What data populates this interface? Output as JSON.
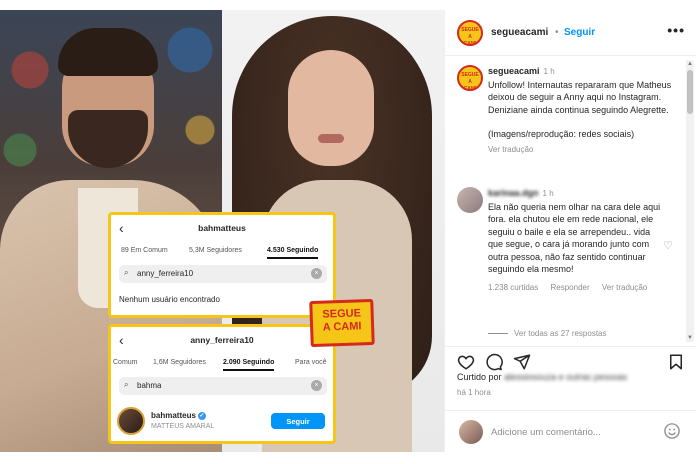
{
  "post": {
    "username": "segueacami",
    "follow_label": "Seguir",
    "dot": "•",
    "more": "•••",
    "logo_text": "SEGUE A CAMI"
  },
  "caption": {
    "username": "segueacami",
    "time": "1 h",
    "text": "Unfollow! Internautas repararam que Matheus deixou de seguir a Anny aqui no Instagram. Deniziane ainda continua seguindo Alegrette.",
    "credit": "(Imagens/reprodução: redes sociais)",
    "translate": "Ver tradução"
  },
  "comment": {
    "username": "karinaa.dgn",
    "time": "1 h",
    "text": "Ela não queria nem olhar na cara dele aqui fora. ela chutou ele em rede nacional, ele seguiu o baile e ela se arrependeu.. vida que segue, o cara já morando junto com outra pessoa, não faz sentido continuar seguindo ela mesmo!",
    "likes": "1.238 curtidas",
    "reply": "Responder",
    "translate": "Ver tradução",
    "replies": "Ver todas as 27 respostas"
  },
  "engagement": {
    "liked_prefix": "Curtido por",
    "liked_by": "alessiosouza e outras pessoas",
    "time": "há 1 hora"
  },
  "add_comment": {
    "placeholder": "Adicione um comentário..."
  },
  "photo": {
    "card1": {
      "title": "bahmatteus",
      "tabs": [
        "89 Em Comum",
        "5,3M Seguidores",
        "4.530 Seguindo"
      ],
      "search_value": "anny_ferreira10",
      "no_result": "Nenhum usuário encontrado"
    },
    "card2": {
      "title": "anny_ferreira10",
      "tabs": [
        "Comum",
        "1,6M Seguidores",
        "2.090 Seguindo",
        "Para você"
      ],
      "search_value": "bahma",
      "user_name": "bahmatteus",
      "user_full": "MATTEUS AMARAL",
      "follow_label": "Seguir"
    },
    "stamp_line1": "SEGUE",
    "stamp_line2": "A CAMI"
  },
  "colors": {
    "link_blue": "#0095f6",
    "brand_yellow": "#f5c518",
    "brand_red": "#d42a1e",
    "muted": "#8e8e8e"
  }
}
